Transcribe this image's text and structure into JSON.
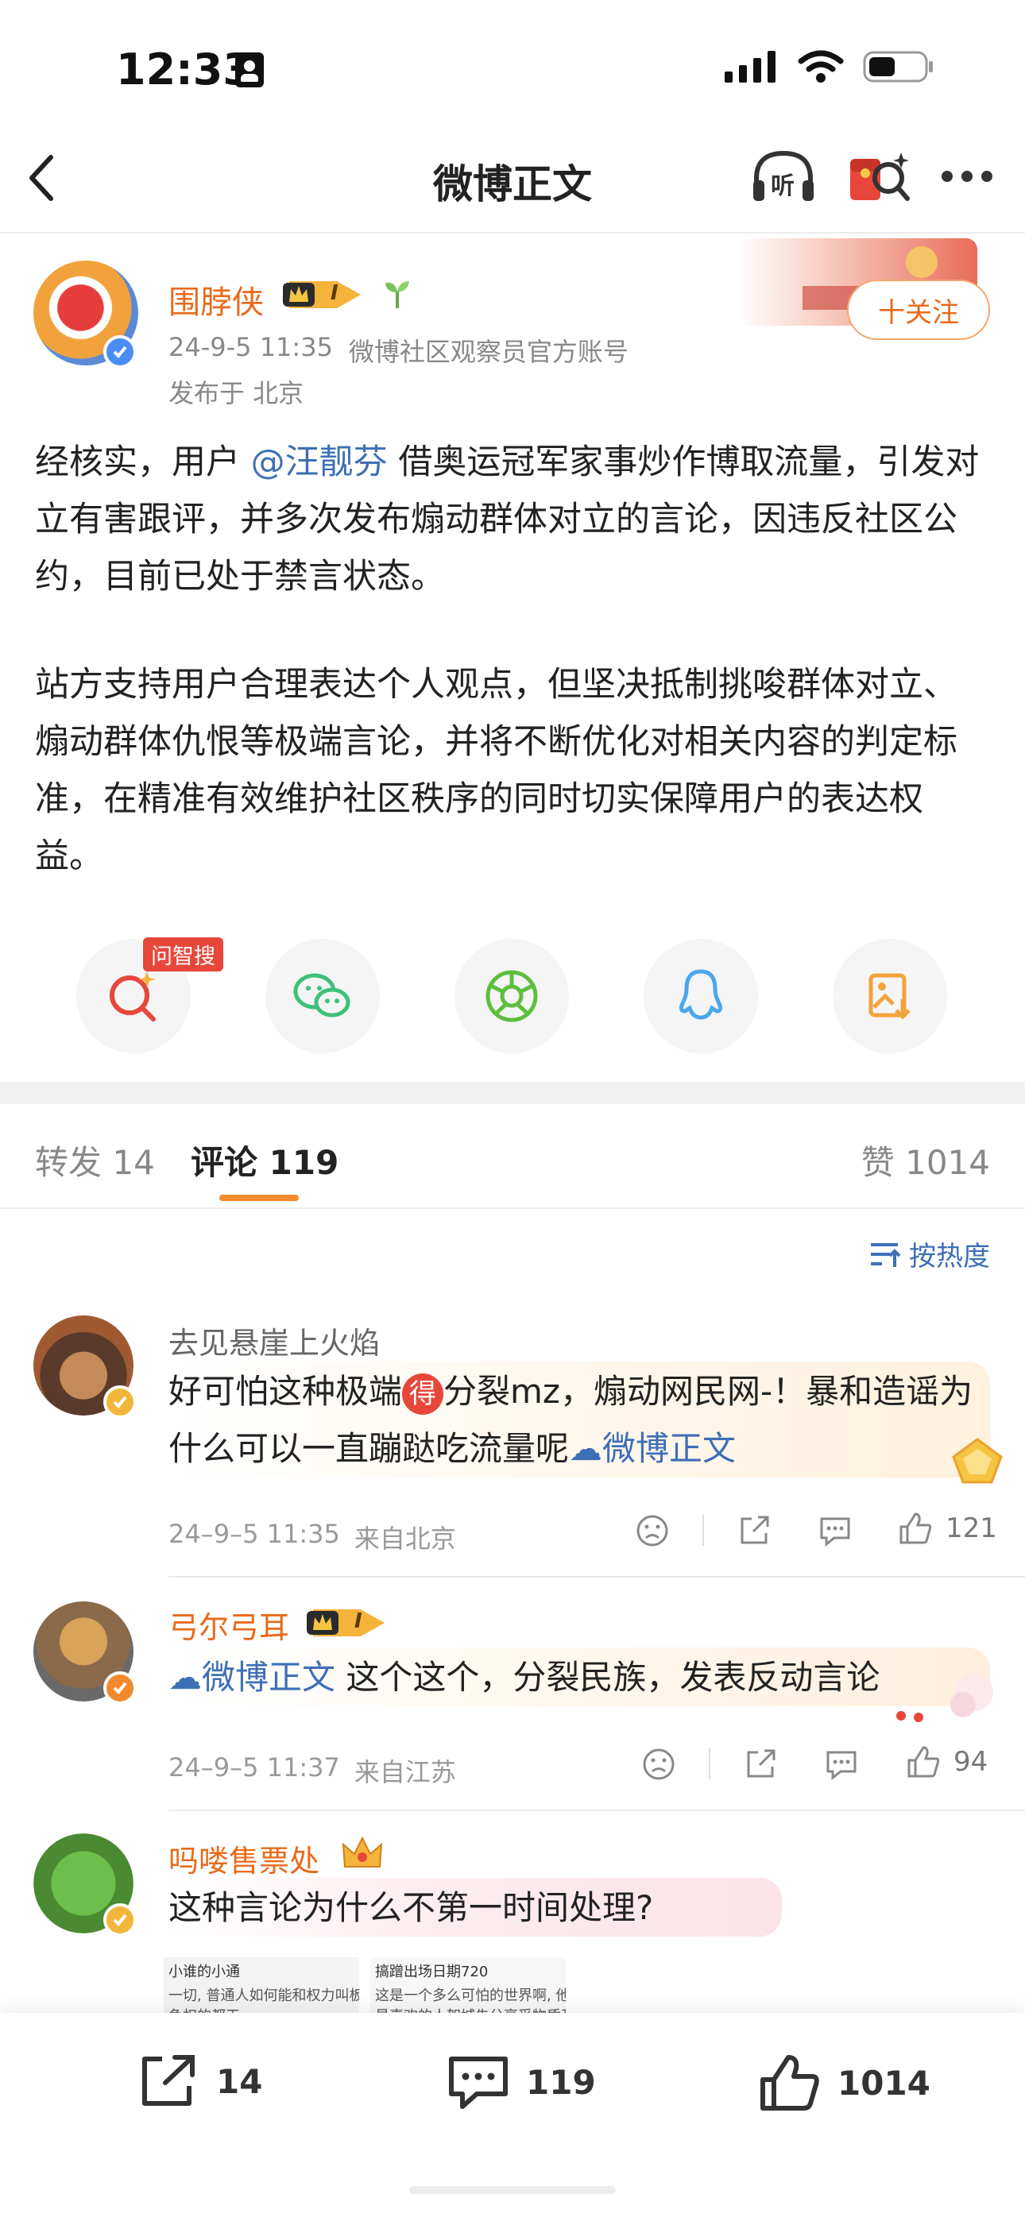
{
  "status_bar": {
    "time": "12:33"
  },
  "nav": {
    "title": "微博正文",
    "listen_label": "听"
  },
  "post": {
    "author": "围脖侠",
    "level_badge": "I",
    "timestamp": "24-9-5 11:35",
    "source": "微博社区观察员官方账号",
    "location": "发布于 北京",
    "follow_label": "十关注",
    "p1_before": "经核实，用户 ",
    "p1_mention": "@汪靓芬",
    "p1_after": " 借奥运冠军家事炒作博取流量，引发对立有害跟评，并多次发布煽动群体对立的言论，因违反社区公约，目前已处于禁言状态。",
    "p2": "站方支持用户合理表达个人观点，但坚决抵制挑唆群体对立、煽动群体仇恨等极端言论，并将不断优化对相关内容的判定标准，在精准有效维护社区秩序的同时切实保障用户的表达权益。"
  },
  "share": {
    "ai_search_tag": "问智搜"
  },
  "tabs": {
    "repost_label": "转发",
    "repost_count": "14",
    "comment_label": "评论",
    "comment_count": "119",
    "like_label": "赞",
    "like_count": "1014"
  },
  "sort_label": "按热度",
  "comments": [
    {
      "name": "去见悬崖上火焰",
      "text_a": "好可怕这种极端",
      "text_badge": "得",
      "text_b": "分裂mz，煽动网民网-！暴和造谣为什么可以一直蹦跶吃流量呢",
      "link": "微博正文",
      "date": "24–9–5 11:35",
      "from": "来自北京",
      "likes": "121"
    },
    {
      "name": "弓尔弓耳",
      "level_badge": "I",
      "link": "微博正文",
      "text": " 这个这个，分裂民族，发表反动言论",
      "date": "24–9–5 11:37",
      "from": "来自江苏",
      "likes": "94"
    },
    {
      "name": "吗喽售票处",
      "text": "这种言论为什么不第一时间处理?",
      "thumb1_title": "小谁的小通",
      "thumb1_line1": "一切, 普通人如何能和权力叫板?",
      "thumb1_line2": "争权的都天",
      "thumb2_title": "搞蹭出场日期720",
      "thumb2_line1": "这是一个多么可怕的世界啊, 他们把人分成",
      "thumb2_line2": "最喜欢的人架城先分享受物质和精神的價值"
    }
  ],
  "bottom_bar": {
    "reposts": "14",
    "comments": "119",
    "likes": "1014"
  },
  "colors": {
    "accent": "#e86a1a",
    "link": "#3d6fb6",
    "red": "#e6473a"
  }
}
